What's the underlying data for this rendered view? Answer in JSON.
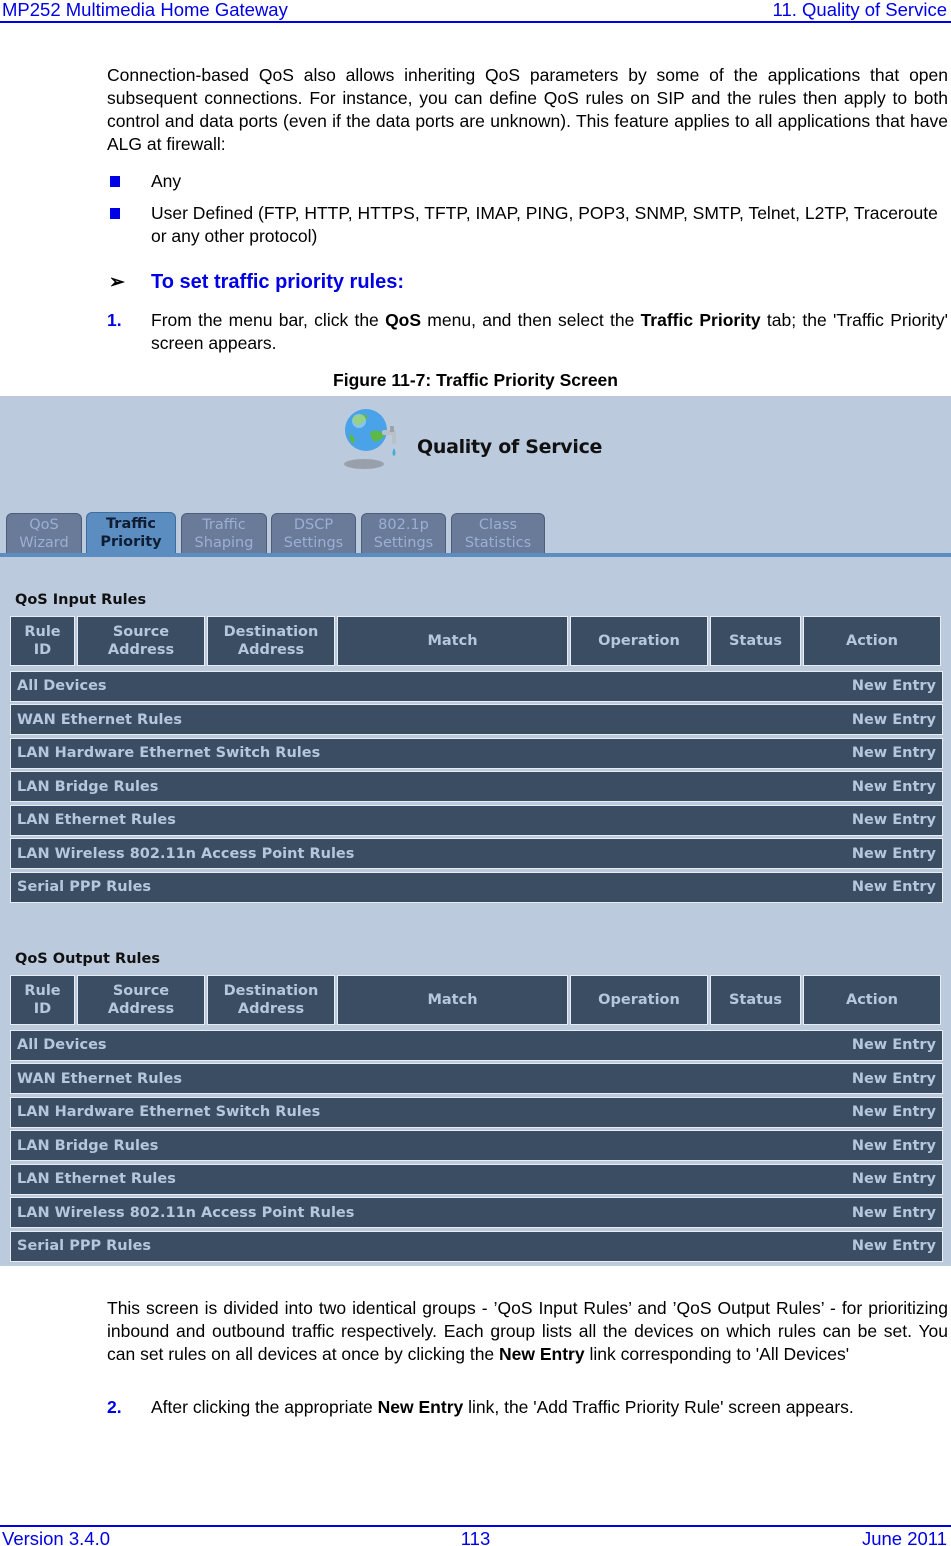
{
  "header": {
    "left": "MP252 Multimedia Home Gateway",
    "right": "11. Quality of Service"
  },
  "intro": "Connection-based QoS also allows inheriting QoS parameters by some of the applications that open subsequent connections. For instance, you can define QoS rules on SIP and the rules then apply to both control and data ports (even if the data ports are unknown). This feature applies to all applications that have ALG at firewall:",
  "bullets": [
    "Any",
    "User Defined (FTP, HTTP, HTTPS, TFTP, IMAP, PING, POP3, SNMP, SMTP, Telnet, L2TP, Traceroute or any other protocol)"
  ],
  "procedure": {
    "arrow": "➢",
    "title": "To set traffic priority rules:"
  },
  "step1": {
    "num": "1.",
    "pre": "From the menu bar, click the ",
    "b1": "QoS",
    "mid": " menu, and then select the ",
    "b2": "Traffic Priority",
    "post": " tab; the 'Traffic Priority' screen appears."
  },
  "figure_caption": "Figure 11-7: Traffic Priority Screen",
  "screen": {
    "title": "Quality of Service",
    "icon": "globe-faucet-icon",
    "tabs": [
      {
        "l1": "QoS",
        "l2": "Wizard",
        "active": false
      },
      {
        "l1": "Traffic",
        "l2": "Priority",
        "active": true
      },
      {
        "l1": "Traffic",
        "l2": "Shaping",
        "active": false
      },
      {
        "l1": "DSCP",
        "l2": "Settings",
        "active": false
      },
      {
        "l1": "802.1p",
        "l2": "Settings",
        "active": false
      },
      {
        "l1": "Class",
        "l2": "Statistics",
        "active": false
      }
    ],
    "columns": [
      {
        "l1": "Rule",
        "l2": "ID"
      },
      {
        "l1": "Source",
        "l2": "Address"
      },
      {
        "l1": "Destination",
        "l2": "Address"
      },
      {
        "l1": "Match",
        "l2": ""
      },
      {
        "l1": "Operation",
        "l2": ""
      },
      {
        "l1": "Status",
        "l2": ""
      },
      {
        "l1": "Action",
        "l2": ""
      }
    ],
    "groups": [
      {
        "title": "QoS Input Rules",
        "rows": [
          "All Devices",
          "WAN Ethernet Rules",
          "LAN Hardware Ethernet Switch Rules",
          "LAN Bridge Rules",
          "LAN Ethernet Rules",
          "LAN Wireless 802.11n Access Point Rules",
          "Serial PPP Rules"
        ]
      },
      {
        "title": "QoS Output Rules",
        "rows": [
          "All Devices",
          "WAN Ethernet Rules",
          "LAN Hardware Ethernet Switch Rules",
          "LAN Bridge Rules",
          "LAN Ethernet Rules",
          "LAN Wireless 802.11n Access Point Rules",
          "Serial PPP Rules"
        ]
      }
    ],
    "new_entry_label": "New Entry"
  },
  "para2": {
    "pre": "This screen is divided into two identical groups - ’QoS Input Rules’ and ’QoS Output Rules’ - for prioritizing inbound and outbound traffic respectively. Each group lists all the devices on which rules can be set. You can set rules on all devices at once by clicking the ",
    "b": "New Entry",
    "post": " link corresponding to 'All Devices'"
  },
  "step2": {
    "num": "2.",
    "pre": "After clicking the appropriate ",
    "b": "New Entry",
    "post": " link, the 'Add Traffic Priority Rule' screen appears."
  },
  "footer": {
    "left": "Version 3.4.0",
    "center": "113",
    "right": "June 2011"
  },
  "colors": {
    "accent_blue": "#0000e6",
    "screen_bg": "#bccade",
    "table_cell": "#3b4d62",
    "active_tab": "#5b8dc0"
  }
}
